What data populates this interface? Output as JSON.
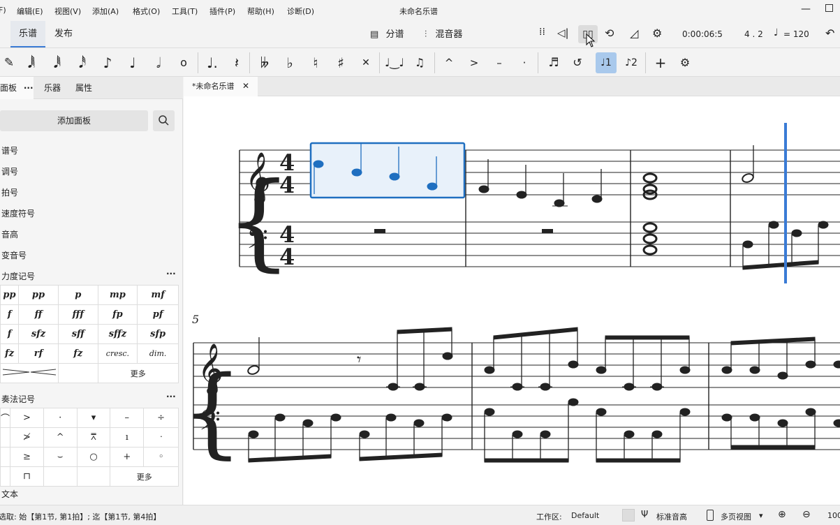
{
  "menu": {
    "items": [
      "F)",
      "编辑(E)",
      "视图(V)",
      "添加(A)",
      "格式(O)",
      "工具(T)",
      "插件(P)",
      "帮助(H)",
      "诊断(D)"
    ],
    "window_title": "未命名乐谱"
  },
  "tabs": {
    "home": "",
    "score": "乐谱",
    "publish": "发布"
  },
  "toolbar": {
    "parts_label": "分谱",
    "mixer_label": "混音器",
    "time": "0:00:06:5",
    "position": "4 . 2",
    "tempo": "= 120"
  },
  "left_panel": {
    "tab_palettes": "面板",
    "tab_instruments": "乐器",
    "tab_properties": "属性",
    "add_palette": "添加面板",
    "palettes": [
      "谱号",
      "调号",
      "拍号",
      "速度符号",
      "音高",
      "变音号"
    ],
    "dynamics_header": "力度记号",
    "dynamics": [
      [
        "pp",
        "pp",
        "p",
        "mp",
        "mf"
      ],
      [
        "f",
        "ff",
        "fff",
        "fp",
        "pf"
      ],
      [
        "f",
        "sfz",
        "sff",
        "sffz",
        "sfp"
      ],
      [
        "fz",
        "rf",
        "fz",
        "cresc.",
        "dim."
      ]
    ],
    "more": "更多",
    "articulations_header": "奏法记号",
    "text_header": "文本"
  },
  "document": {
    "tab_name": "*未命名乐谱"
  },
  "score": {
    "system2_measure_number": "5"
  },
  "status": {
    "selection": "选取: 始【第1节, 第1拍】; 迄【第1节, 第4拍】",
    "workspace_label": "工作区:",
    "workspace_value": "Default",
    "concert_pitch": "标准音高",
    "view_mode": "多页视图",
    "zoom": "100"
  },
  "colors": {
    "accent": "#3a7bd5",
    "selection": "#1f6fc0",
    "selection_fill": "#e8f1fa"
  }
}
